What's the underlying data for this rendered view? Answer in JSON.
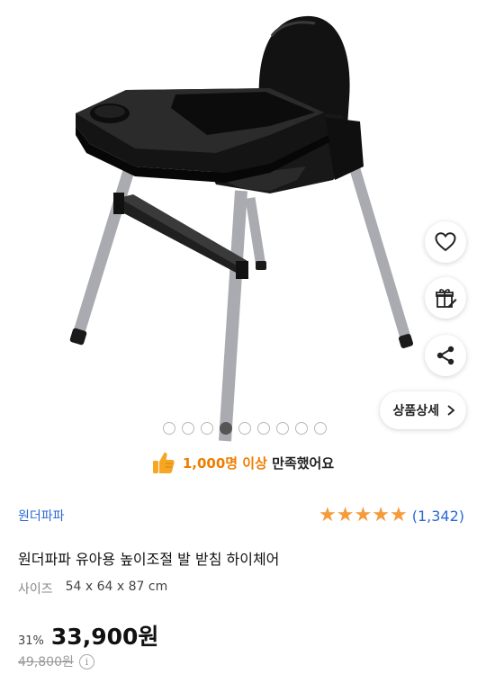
{
  "product_image": {
    "alt": "high chair photo"
  },
  "actions": {
    "wishlist_icon": "heart-icon",
    "gift_icon": "gift-icon",
    "share_icon": "share-icon",
    "detail_label": "상품상세"
  },
  "carousel": {
    "total": 9,
    "active_index": 3
  },
  "satisfaction": {
    "highlight": "1,000명 이상",
    "rest": "만족했어요"
  },
  "product": {
    "brand": "원더파파",
    "rating_stars": 5,
    "review_count": "(1,342)",
    "title": "원더파파 유아용 높이조절 발 받침 하이체어",
    "size_label": "사이즈",
    "size_value": "54 x 64 x 87 cm"
  },
  "price": {
    "discount": "31%",
    "current": "33,900원",
    "original": "49,800원"
  },
  "colors": {
    "accent": "#ef7d00",
    "link": "#2a6ad4",
    "star": "#f59b3c"
  }
}
